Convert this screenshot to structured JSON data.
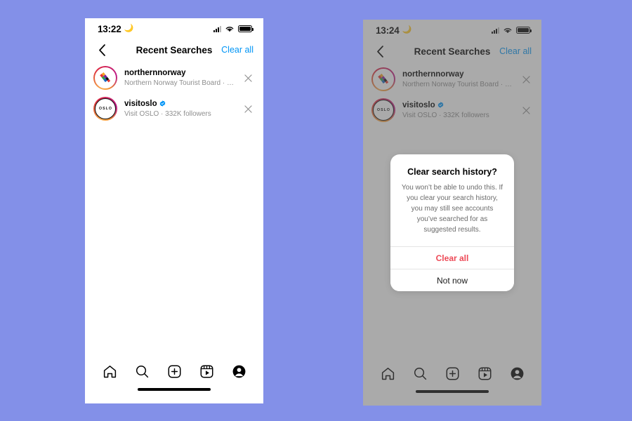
{
  "theme": {
    "background": "#8390e8",
    "link_blue": "#0095f6",
    "destructive_red": "#ed4956",
    "muted_gray": "#8e8e8e"
  },
  "phones": [
    {
      "id": "left",
      "status_bar": {
        "time": "13:22",
        "moon_icon": "crescent-moon-icon",
        "signal_icon": "cellular-signal-icon",
        "wifi_icon": "wifi-icon",
        "battery_icon": "battery-full-icon"
      },
      "header": {
        "back_icon": "back-chevron-icon",
        "title": "Recent Searches",
        "clear_all_label": "Clear all"
      },
      "results": [
        {
          "username": "northernnorway",
          "subtitle": "Northern Norway Tourist Board · Followed by...",
          "verified": false,
          "avatar_type": "gradient-logo",
          "close_icon": "close-icon"
        },
        {
          "username": "visitoslo",
          "subtitle": "Visit OSLO · 332K followers",
          "verified": true,
          "avatar_type": "oslo-text",
          "avatar_text": "OSLO",
          "close_icon": "close-icon"
        }
      ],
      "bottom_nav": [
        {
          "icon": "home-icon",
          "label": "Home"
        },
        {
          "icon": "search-icon",
          "label": "Search"
        },
        {
          "icon": "add-post-icon",
          "label": "Create"
        },
        {
          "icon": "reels-icon",
          "label": "Reels"
        },
        {
          "icon": "profile-icon",
          "label": "Profile"
        }
      ],
      "dialog": null
    },
    {
      "id": "right",
      "status_bar": {
        "time": "13:24",
        "moon_icon": "crescent-moon-icon",
        "signal_icon": "cellular-signal-icon",
        "wifi_icon": "wifi-icon",
        "battery_icon": "battery-full-icon"
      },
      "header": {
        "back_icon": "back-chevron-icon",
        "title": "Recent Searches",
        "clear_all_label": "Clear all"
      },
      "results": [
        {
          "username": "northernnorway",
          "subtitle": "Northern Norway Tourist Board · Followed by...",
          "verified": false,
          "avatar_type": "gradient-logo",
          "close_icon": "close-icon"
        },
        {
          "username": "visitoslo",
          "subtitle": "Visit OSLO · 332K followers",
          "verified": true,
          "avatar_type": "oslo-text",
          "avatar_text": "OSLO",
          "close_icon": "close-icon"
        }
      ],
      "bottom_nav": [
        {
          "icon": "home-icon",
          "label": "Home"
        },
        {
          "icon": "search-icon",
          "label": "Search"
        },
        {
          "icon": "add-post-icon",
          "label": "Create"
        },
        {
          "icon": "reels-icon",
          "label": "Reels"
        },
        {
          "icon": "profile-icon",
          "label": "Profile"
        }
      ],
      "dialog": {
        "title": "Clear search history?",
        "message": "You won’t be able to undo this. If you clear your search history, you may still see accounts you’ve searched for as suggested results.",
        "confirm_label": "Clear all",
        "cancel_label": "Not now"
      }
    }
  ]
}
